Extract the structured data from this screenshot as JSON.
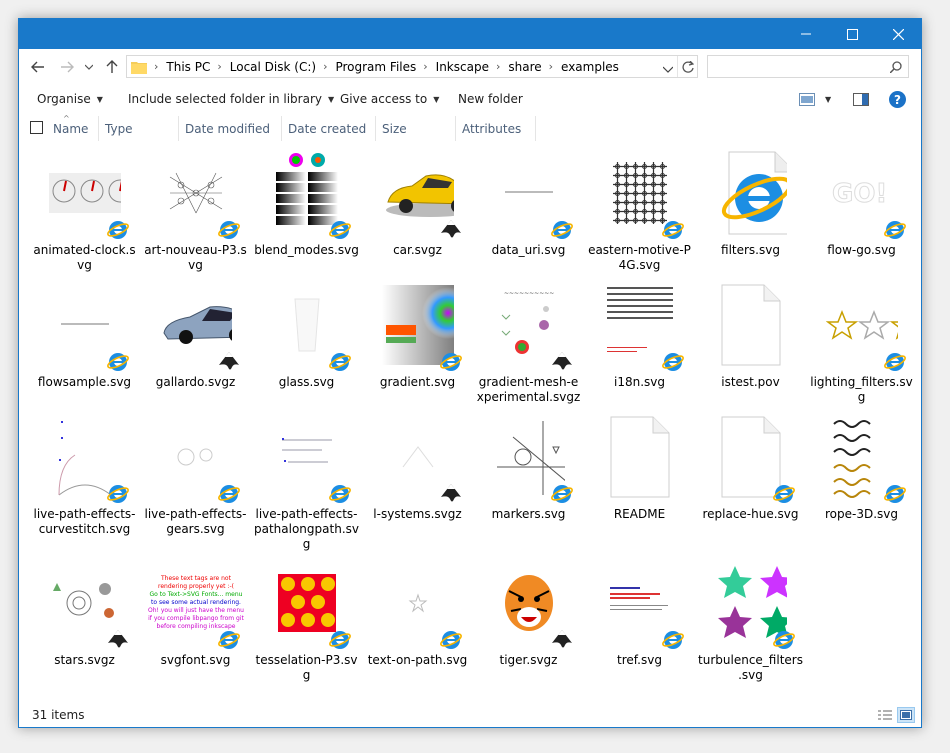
{
  "window": {
    "controls": {
      "minimize": "minimize-icon",
      "maximize": "maximize-icon",
      "close": "close-icon"
    }
  },
  "address": {
    "breadcrumb": [
      "This PC",
      "Local Disk (C:)",
      "Program Files",
      "Inkscape",
      "share",
      "examples"
    ],
    "search_placeholder": ""
  },
  "toolbar": {
    "organise": "Organise",
    "include": "Include selected folder in library",
    "give_access": "Give access to",
    "new_folder": "New folder"
  },
  "columns": [
    "Name",
    "Type",
    "Date modified",
    "Date created",
    "Size",
    "Attributes"
  ],
  "files": [
    {
      "name": "animated-clock.svg",
      "label1": "animated-clock.s",
      "label2": "vg",
      "overlay": "ie"
    },
    {
      "name": "art-nouveau-P3.svg",
      "label1": "art-nouveau-P3.s",
      "label2": "vg",
      "overlay": "ie"
    },
    {
      "name": "blend_modes.svg",
      "label1": "blend_modes.svg",
      "label2": "",
      "overlay": "ie"
    },
    {
      "name": "car.svgz",
      "label1": "car.svgz",
      "label2": "",
      "overlay": "inkscape"
    },
    {
      "name": "data_uri.svg",
      "label1": "data_uri.svg",
      "label2": "",
      "overlay": "ie"
    },
    {
      "name": "eastern-motive-P4G.svg",
      "label1": "eastern-motive-P",
      "label2": "4G.svg",
      "overlay": "ie"
    },
    {
      "name": "filters.svg",
      "label1": "filters.svg",
      "label2": "",
      "overlay": "ie-big"
    },
    {
      "name": "flow-go.svg",
      "label1": "flow-go.svg",
      "label2": "",
      "overlay": "ie"
    },
    {
      "name": "flowsample.svg",
      "label1": "flowsample.svg",
      "label2": "",
      "overlay": "ie"
    },
    {
      "name": "gallardo.svgz",
      "label1": "gallardo.svgz",
      "label2": "",
      "overlay": "inkscape"
    },
    {
      "name": "glass.svg",
      "label1": "glass.svg",
      "label2": "",
      "overlay": "ie"
    },
    {
      "name": "gradient.svg",
      "label1": "gradient.svg",
      "label2": "",
      "overlay": "ie"
    },
    {
      "name": "gradient-mesh-experimental.svgz",
      "label1": "gradient-mesh-e",
      "label2": "xperimental.svgz",
      "overlay": "inkscape"
    },
    {
      "name": "i18n.svg",
      "label1": "i18n.svg",
      "label2": "",
      "overlay": "ie"
    },
    {
      "name": "istest.pov",
      "label1": "istest.pov",
      "label2": "",
      "overlay": "none"
    },
    {
      "name": "lighting_filters.svg",
      "label1": "lighting_filters.sv",
      "label2": "g",
      "overlay": "ie"
    },
    {
      "name": "live-path-effects-curvestitch.svg",
      "label1": "live-path-effects-",
      "label2": "curvestitch.svg",
      "overlay": "ie"
    },
    {
      "name": "live-path-effects-gears.svg",
      "label1": "live-path-effects-",
      "label2": "gears.svg",
      "overlay": "ie"
    },
    {
      "name": "live-path-effects-pathalongpath.svg",
      "label1": "live-path-effects-",
      "label2": "pathalongpath.sv",
      "label3": "g",
      "overlay": "ie"
    },
    {
      "name": "l-systems.svgz",
      "label1": "l-systems.svgz",
      "label2": "",
      "overlay": "inkscape"
    },
    {
      "name": "markers.svg",
      "label1": "markers.svg",
      "label2": "",
      "overlay": "ie"
    },
    {
      "name": "README",
      "label1": "README",
      "label2": "",
      "overlay": "none"
    },
    {
      "name": "replace-hue.svg",
      "label1": "replace-hue.svg",
      "label2": "",
      "overlay": "ie"
    },
    {
      "name": "rope-3D.svg",
      "label1": "rope-3D.svg",
      "label2": "",
      "overlay": "ie"
    },
    {
      "name": "stars.svgz",
      "label1": "stars.svgz",
      "label2": "",
      "overlay": "inkscape"
    },
    {
      "name": "svgfont.svg",
      "label1": "svgfont.svg",
      "label2": "",
      "overlay": "ie"
    },
    {
      "name": "tesselation-P3.svg",
      "label1": "tesselation-P3.sv",
      "label2": "g",
      "overlay": "ie"
    },
    {
      "name": "text-on-path.svg",
      "label1": "text-on-path.svg",
      "label2": "",
      "overlay": "ie"
    },
    {
      "name": "tiger.svgz",
      "label1": "tiger.svgz",
      "label2": "",
      "overlay": "inkscape"
    },
    {
      "name": "tref.svg",
      "label1": "tref.svg",
      "label2": "",
      "overlay": "ie"
    },
    {
      "name": "turbulence_filters.svg",
      "label1": "turbulence_filters",
      "label2": ".svg",
      "overlay": "ie"
    }
  ],
  "thumbnail_text": {
    "svgfont": [
      "These text tags are not",
      "rendering properly yet :-(",
      "Go to Text->SVG Fonts... menu",
      "to see some actual rendering.",
      "Oh! you will just have the menu",
      "if you compile libpango from git",
      "before compiling inkscape"
    ],
    "flow_go": "GO!"
  },
  "status": {
    "count": "31 items"
  },
  "colors": {
    "accent": "#1979ca",
    "ie_blue": "#1c8ee3",
    "ie_ring": "#f7b500",
    "header_text": "#4c607a"
  }
}
